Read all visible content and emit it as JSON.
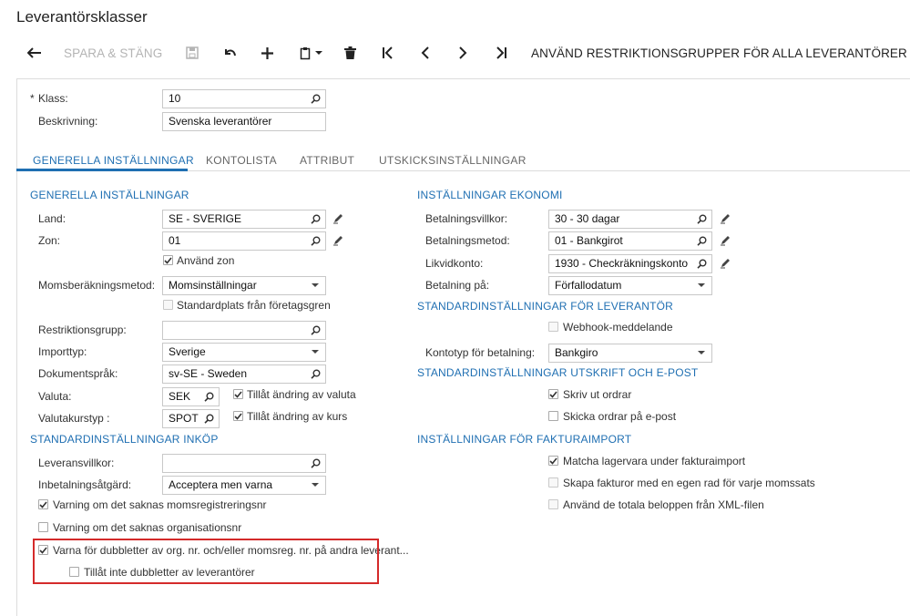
{
  "page_title": "Leverantörsklasser",
  "toolbar": {
    "save_close": "SPARA & STÄNG",
    "apply_restriction": "ANVÄND RESTRIKTIONSGRUPPER FÖR ALLA LEVERANTÖRER"
  },
  "header": {
    "klass_label": "Klass:",
    "required_mark": "*",
    "klass_value": "10",
    "beskrivning_label": "Beskrivning:",
    "beskrivning_value": "Svenska leverantörer"
  },
  "tabs": [
    "GENERELLA INSTÄLLNINGAR",
    "KONTOLISTA",
    "ATTRIBUT",
    "UTSKICKSINSTÄLLNINGAR"
  ],
  "general": {
    "title": "GENERELLA INSTÄLLNINGAR",
    "land_label": "Land:",
    "land_value": "SE - SVERIGE",
    "zon_label": "Zon:",
    "zon_value": "01",
    "use_zone": "Använd zon",
    "moms_label": "Momsberäkningsmetod:",
    "moms_value": "Momsinställningar",
    "std_place": "Standardplats från företagsgren",
    "restr_label": "Restriktionsgrupp:",
    "restr_value": "",
    "import_label": "Importtyp:",
    "import_value": "Sverige",
    "lang_label": "Dokumentspråk:",
    "lang_value": "sv-SE - Sweden",
    "valuta_label": "Valuta:",
    "valuta_value": "SEK",
    "allow_valuta": "Tillåt ändring av valuta",
    "kurstyp_label": "Valutakurstyp :",
    "kurstyp_value": "SPOT",
    "allow_kurs": "Tillåt ändring av kurs"
  },
  "purchase": {
    "title": "STANDARDINSTÄLLNINGAR INKÖP",
    "lev_label": "Leveransvillkor:",
    "lev_value": "",
    "inbet_label": "Inbetalningsåtgärd:",
    "inbet_value": "Acceptera men varna",
    "warn_moms": "Varning om det saknas momsregistreringsnr",
    "warn_org": "Varning om det saknas organisationsnr",
    "warn_dup": "Varna för dubbletter av org. nr. och/eller momsreg. nr. på andra leverant...",
    "no_dup": "Tillåt inte dubbletter av leverantörer"
  },
  "economy": {
    "title": "INSTÄLLNINGAR EKONOMI",
    "bv_label": "Betalningsvillkor:",
    "bv_value": "30 - 30 dagar",
    "bm_label": "Betalningsmetod:",
    "bm_value": "01 - Bankgirot",
    "lk_label": "Likvidkonto:",
    "lk_value": "1930 - Checkräkningskonto",
    "bp_label": "Betalning på:",
    "bp_value": "Förfallodatum"
  },
  "supplier": {
    "title": "STANDARDINSTÄLLNINGAR FÖR LEVERANTÖR",
    "webhook": "Webhook-meddelande",
    "kt_label": "Kontotyp för betalning:",
    "kt_value": "Bankgiro"
  },
  "print": {
    "title": "STANDARDINSTÄLLNINGAR UTSKRIFT OCH E-POST",
    "print_orders": "Skriv ut ordrar",
    "email_orders": "Skicka ordrar på e-post"
  },
  "invoice": {
    "title": "INSTÄLLNINGAR FÖR FAKTURAIMPORT",
    "match": "Matcha lagervara under fakturaimport",
    "create_rows": "Skapa fakturor med en egen rad för varje momssats",
    "use_totals": "Använd de totala beloppen från XML-filen"
  },
  "colors": {
    "accent": "#1f6fb2",
    "highlight": "#d42a2a"
  }
}
